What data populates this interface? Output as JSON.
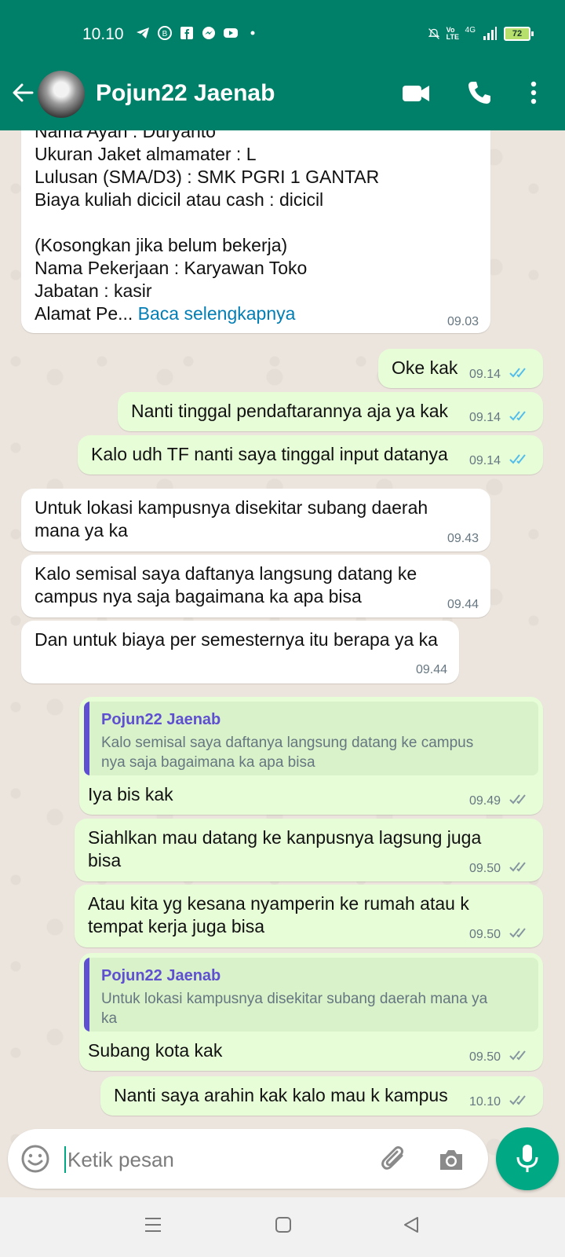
{
  "status_bar": {
    "time": "10.10",
    "network": "4G",
    "volte": "Vo LTE",
    "battery": "72"
  },
  "header": {
    "contact_name": "Pojun22 Jaenab",
    "icons": [
      "back-arrow-icon",
      "video-call-icon",
      "voice-call-icon",
      "more-options-icon"
    ],
    "color": "#008069"
  },
  "messages": [
    {
      "dir": "in",
      "lines": [
        "Nama Ayah : Duryanto",
        "Ukuran Jaket almamater : L",
        "Lulusan (SMA/D3) : SMK PGRI 1 GANTAR",
        "Biaya kuliah dicicil atau cash : dicicil",
        "",
        "(Kosongkan jika belum bekerja)",
        "Nama Pekerjaan : Karyawan Toko",
        "Jabatan : kasir"
      ],
      "last_line_prefix": "Alamat Pe...",
      "read_more": "Baca selengkapnya",
      "time": "09.03"
    },
    {
      "dir": "out",
      "lines": [
        "Oke kak"
      ],
      "time": "09.14",
      "status": "read"
    },
    {
      "dir": "out",
      "lines": [
        "Nanti tinggal pendaftarannya aja ya kak"
      ],
      "time": "09.14",
      "status": "read"
    },
    {
      "dir": "out",
      "lines": [
        "Kalo udh TF nanti saya tinggal input datanya"
      ],
      "time": "09.14",
      "status": "read"
    },
    {
      "dir": "in",
      "lines": [
        "Untuk lokasi kampusnya disekitar subang daerah",
        "mana ya ka"
      ],
      "time": "09.43"
    },
    {
      "dir": "in",
      "lines": [
        "Kalo semisal saya daftanya langsung datang ke",
        "campus nya saja bagaimana ka apa bisa"
      ],
      "time": "09.44"
    },
    {
      "dir": "in",
      "lines": [
        "Dan untuk biaya per semesternya itu berapa ya ka"
      ],
      "time": "09.44"
    },
    {
      "dir": "out",
      "quote": {
        "name": "Pojun22 Jaenab",
        "lines": [
          "Kalo semisal saya daftanya langsung datang ke campus",
          "nya saja bagaimana ka apa bisa"
        ]
      },
      "lines": [
        "Iya bis kak"
      ],
      "time": "09.49",
      "status": "delivered"
    },
    {
      "dir": "out",
      "lines": [
        "Siahlkan mau datang ke kanpusnya lagsung juga",
        "bisa"
      ],
      "time": "09.50",
      "status": "delivered"
    },
    {
      "dir": "out",
      "lines": [
        "Atau kita yg kesana nyamperin ke rumah atau k",
        "tempat kerja juga bisa"
      ],
      "time": "09.50",
      "status": "delivered"
    },
    {
      "dir": "out",
      "quote": {
        "name": "Pojun22 Jaenab",
        "lines": [
          "Untuk lokasi kampusnya disekitar subang daerah mana ya",
          "ka"
        ]
      },
      "lines": [
        "Subang kota kak"
      ],
      "time": "09.50",
      "status": "delivered"
    },
    {
      "dir": "out",
      "lines": [
        "Nanti saya arahin kak kalo mau k kampus"
      ],
      "time": "10.10",
      "status": "delivered"
    }
  ],
  "composer": {
    "placeholder": "Ketik pesan",
    "icons": [
      "emoji-icon",
      "attach-icon",
      "camera-icon",
      "mic-icon"
    ]
  },
  "colors": {
    "outgoing_bubble": "#e7fdd8",
    "incoming_bubble": "#ffffff",
    "read_tick": "#53bdeb",
    "delivered_tick": "#8696a0",
    "quote_accent": "#5f4fd1",
    "link": "#027eb5"
  }
}
